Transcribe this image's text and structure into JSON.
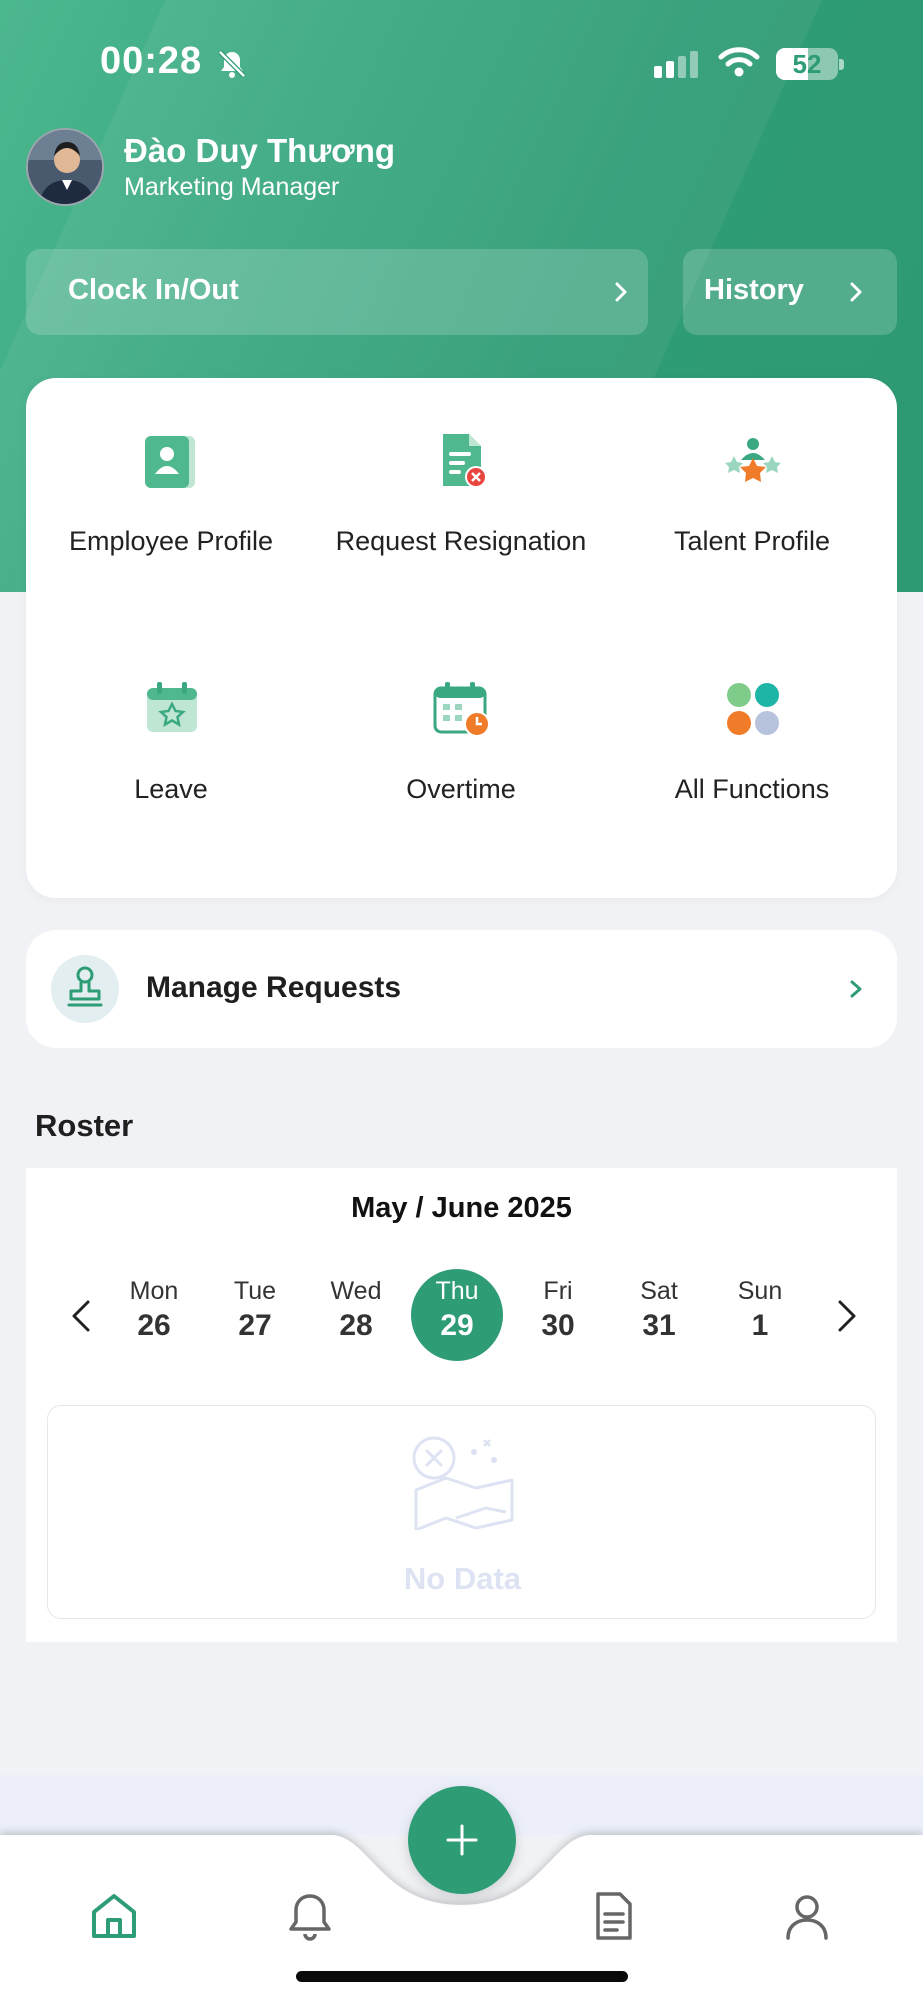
{
  "status_bar": {
    "time": "00:28",
    "battery": "52",
    "battery_level": 0.52
  },
  "user": {
    "name": "Đào Duy Thương",
    "role": "Marketing Manager"
  },
  "actions": {
    "clock_label": "Clock In/Out",
    "history_label": "History"
  },
  "functions": [
    {
      "label": "Employee Profile",
      "icon": "employee-profile-icon"
    },
    {
      "label": "Request Resignation",
      "icon": "request-resignation-icon"
    },
    {
      "label": "Talent Profile",
      "icon": "talent-profile-icon"
    },
    {
      "label": "Leave",
      "icon": "leave-calendar-icon"
    },
    {
      "label": "Overtime",
      "icon": "overtime-calendar-icon"
    },
    {
      "label": "All Functions",
      "icon": "all-functions-icon"
    }
  ],
  "manage": {
    "label": "Manage Requests"
  },
  "roster": {
    "title": "Roster",
    "month": "May / June 2025",
    "days": [
      {
        "name": "Mon",
        "date": "26"
      },
      {
        "name": "Tue",
        "date": "27"
      },
      {
        "name": "Wed",
        "date": "28"
      },
      {
        "name": "Thu",
        "date": "29",
        "selected": true
      },
      {
        "name": "Fri",
        "date": "30"
      },
      {
        "name": "Sat",
        "date": "31"
      },
      {
        "name": "Sun",
        "date": "1"
      }
    ],
    "empty_label": "No Data"
  },
  "tabbar": {
    "tabs": [
      "home-icon",
      "notifications-icon",
      "documents-icon",
      "profile-icon"
    ],
    "fab": "plus-icon"
  },
  "colors": {
    "primary": "#2e9c75",
    "accent_orange": "#f07c2a",
    "background": "#f1f2f6"
  }
}
